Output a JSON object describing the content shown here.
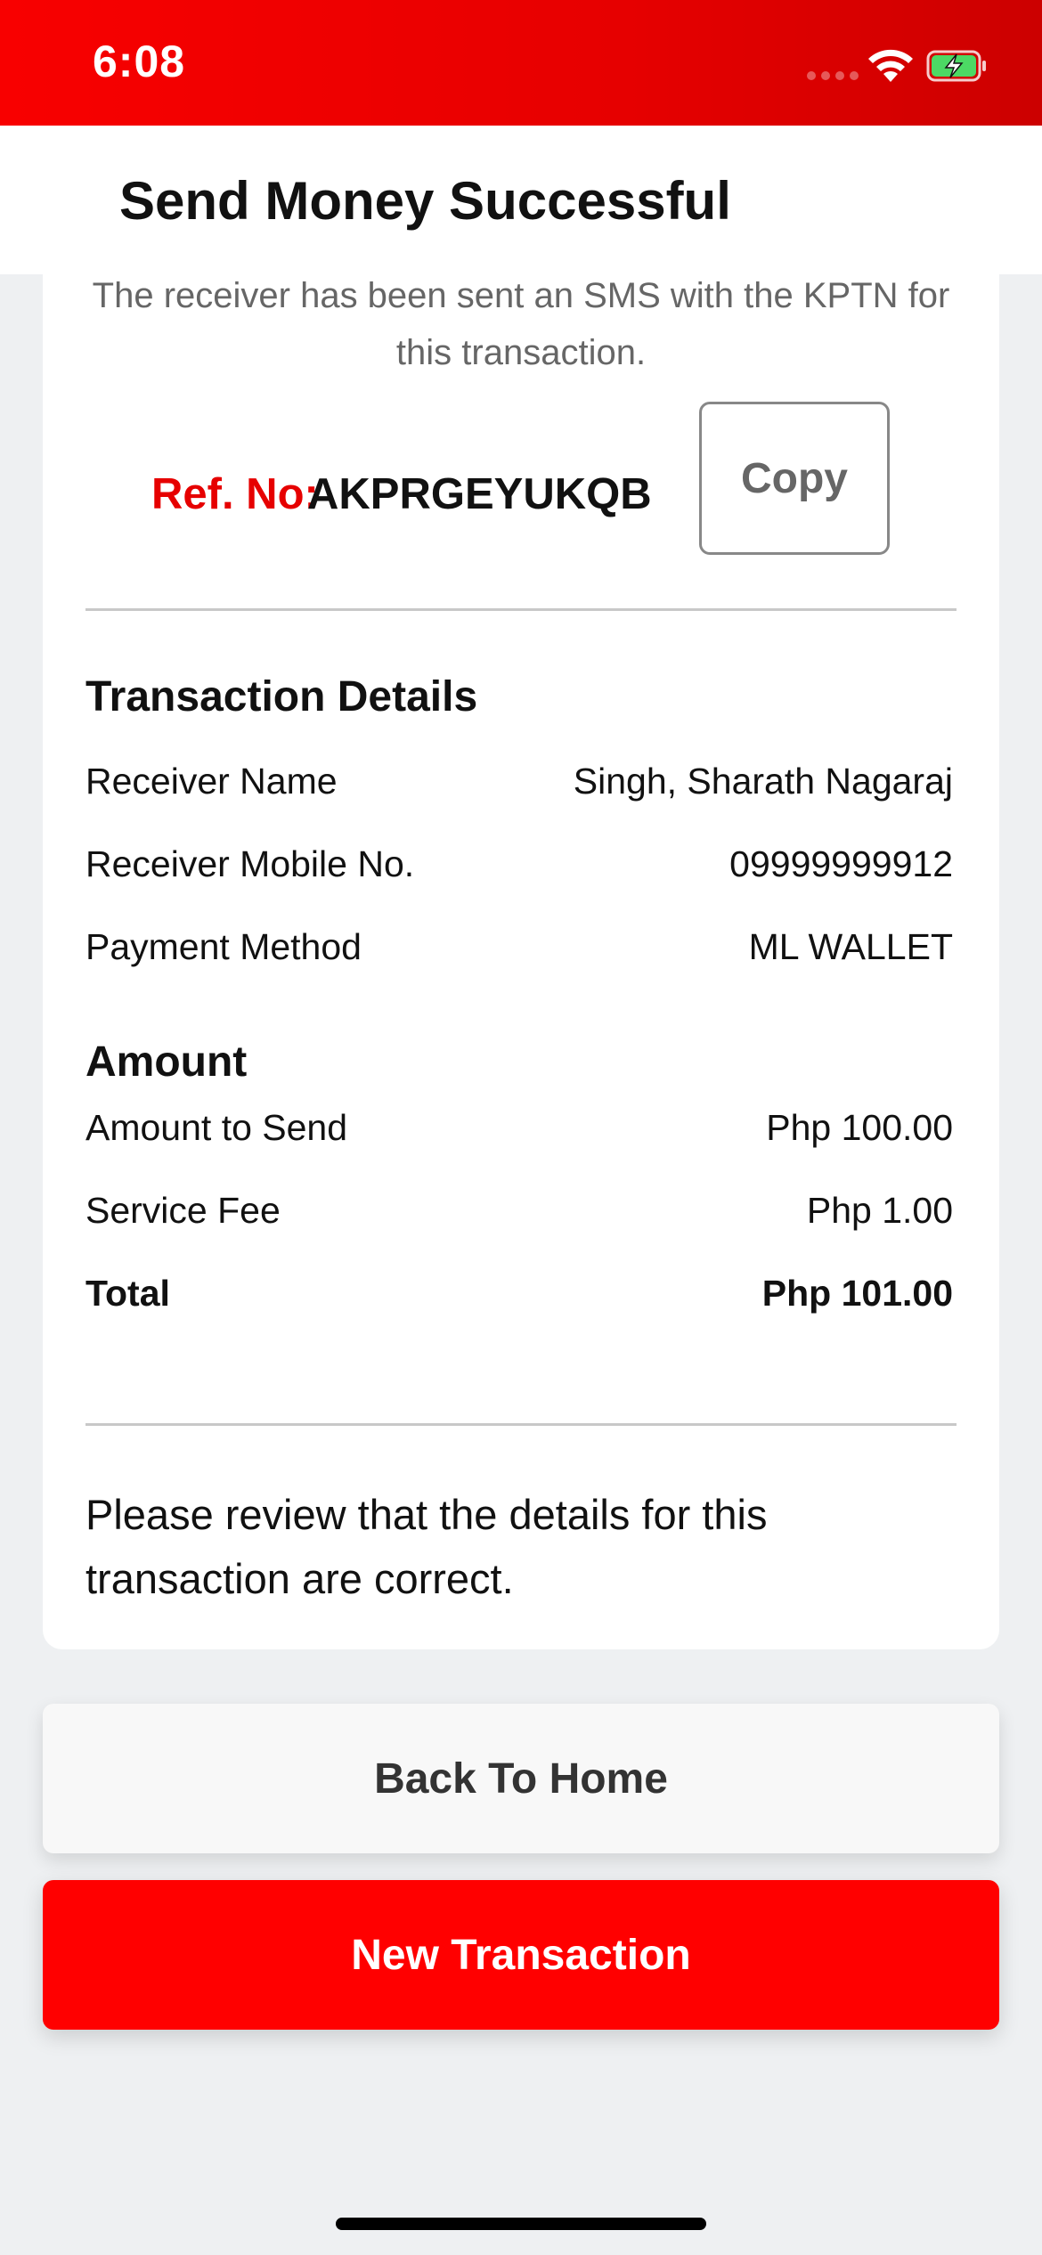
{
  "status_bar": {
    "time": "6:08"
  },
  "header": {
    "title": "Send Money Successful"
  },
  "card": {
    "sms_note": "The receiver has been sent an SMS with the KPTN for this transaction.",
    "ref_label": "Ref. No:",
    "ref_value": "AKPRGEYUKQB",
    "copy_label": "Copy",
    "transaction_details": {
      "title": "Transaction Details",
      "rows": [
        {
          "label": "Receiver Name",
          "value": "Singh, Sharath Nagaraj"
        },
        {
          "label": "Receiver Mobile No.",
          "value": "09999999912"
        },
        {
          "label": "Payment Method",
          "value": "ML WALLET"
        }
      ]
    },
    "amount": {
      "title": "Amount",
      "rows": [
        {
          "label": "Amount to Send",
          "value": "Php 100.00"
        },
        {
          "label": "Service Fee",
          "value": "Php 1.00"
        },
        {
          "label": "Total",
          "value": "Php 101.00"
        }
      ]
    },
    "review_note": "Please review that the details for this transaction are correct."
  },
  "buttons": {
    "back_home": "Back To Home",
    "new_transaction": "New Transaction"
  },
  "colors": {
    "accent": "#ff0000",
    "ref_label": "#e60000",
    "page_bg": "#eef0f2"
  }
}
